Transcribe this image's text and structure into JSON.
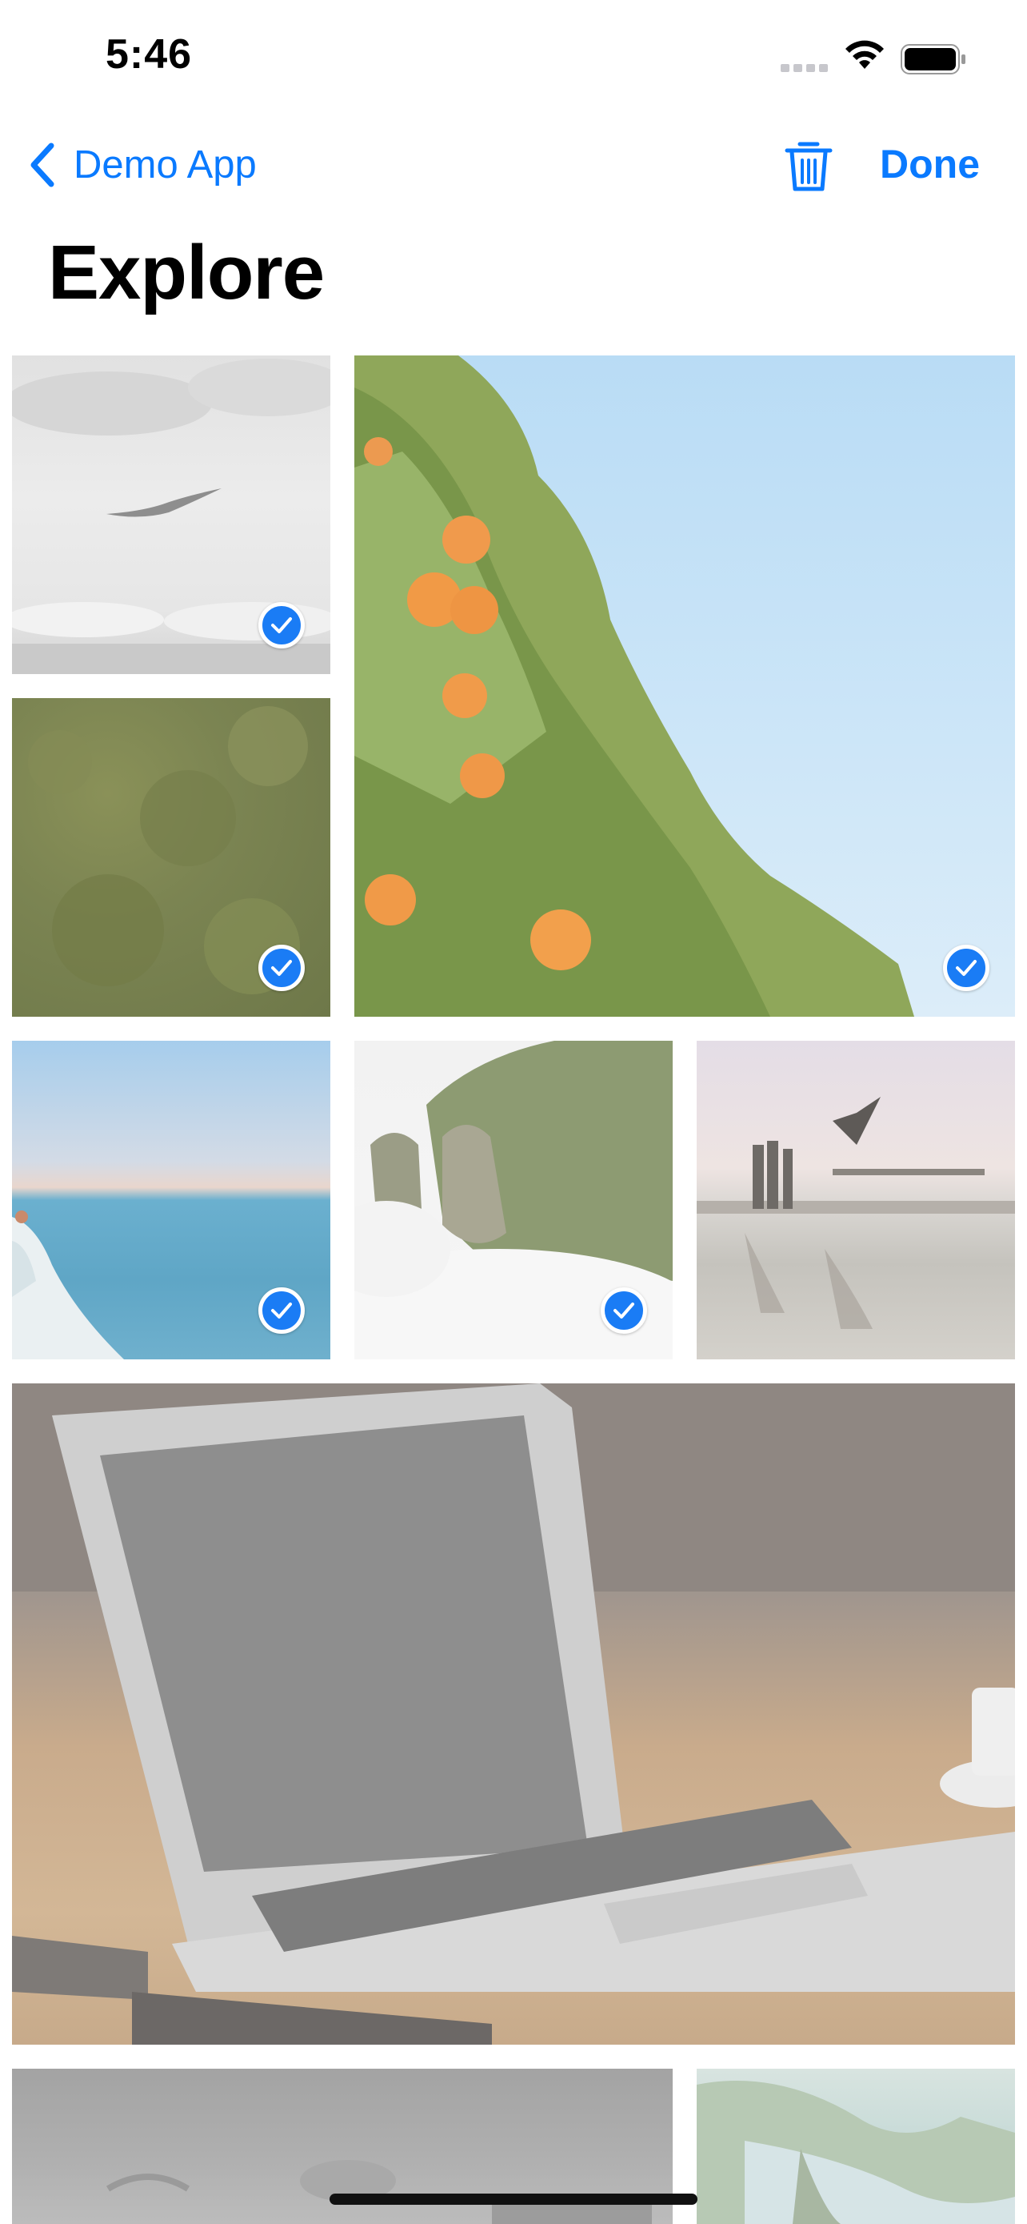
{
  "status_bar": {
    "time": "5:46",
    "icons": [
      "cellular-signal-icon",
      "wifi-icon",
      "battery-icon"
    ]
  },
  "nav": {
    "back_label": "Demo App",
    "back_icon": "chevron-left-icon",
    "trash_icon": "trash-icon",
    "done_label": "Done",
    "accent_color": "#0a7aff"
  },
  "page": {
    "title": "Explore"
  },
  "photos": [
    {
      "subject": "seagull over sea",
      "selected": true
    },
    {
      "subject": "orange tree against sky",
      "selected": true
    },
    {
      "subject": "green foliage texture",
      "selected": true
    },
    {
      "subject": "ocean coastline",
      "selected": true
    },
    {
      "subject": "misty cliffs",
      "selected": true
    },
    {
      "subject": "people jumping at pool",
      "selected": false
    },
    {
      "subject": "laptop on wooden desk",
      "selected": false
    },
    {
      "subject": "glasses on desk",
      "selected": false
    },
    {
      "subject": "mountain lake",
      "selected": false
    }
  ],
  "selection_color": "#1a7cf5"
}
